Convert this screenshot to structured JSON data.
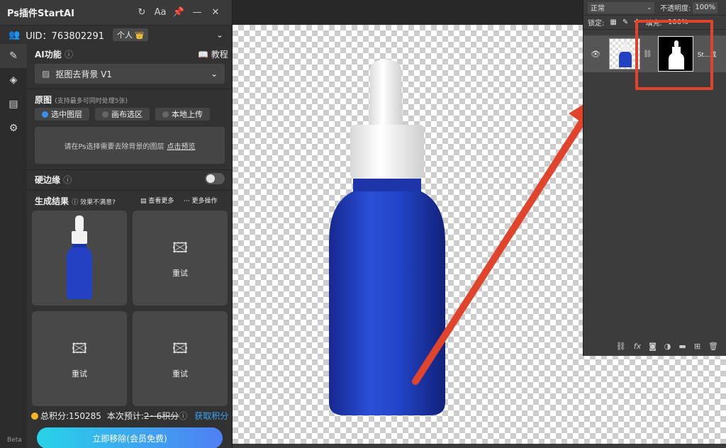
{
  "plugin": {
    "title": "Ps插件StartAI",
    "titlebar_icons": {
      "refresh": "↻",
      "font": "Aa",
      "pin": "📌",
      "minimize": "—",
      "close": "✕"
    },
    "uid_label": "UID：763802291",
    "plan_badge": "个人",
    "crown_icon": "👑",
    "ai_function": {
      "title": "AI功能",
      "tutorial_label": "教程",
      "selected_tool": "抠图去背景 V1"
    },
    "source": {
      "title": "原图",
      "hint": "(支持最多可同时处理5张)",
      "options": [
        "选中图层",
        "画布选区",
        "本地上传"
      ],
      "selected_index": 0,
      "prompt": "请在Ps选择需要去除背景的图层",
      "preview_link": "点击预览"
    },
    "hard_edge": {
      "label": "硬边缘",
      "enabled": false
    },
    "results": {
      "title": "生成结果",
      "dissatisfied": "效果不满意?",
      "view_more": "查看更多",
      "more_actions": "更多操作",
      "retry_label": "重试"
    },
    "points": {
      "total": "总积分:150285",
      "estimate_label": "本次预计:",
      "estimate_value": "2~6积分",
      "get_points": "获取积分"
    },
    "cta_label": "立即移除(会员免费)",
    "beta_label": "Beta"
  },
  "layers_panel": {
    "blend_mode": "正常",
    "opacity_label": "不透明度:",
    "opacity_value": "100%",
    "lock_label": "锁定:",
    "fill_label": "填充:",
    "fill_value": "100%",
    "layer_name": "St...成"
  },
  "colors": {
    "accent_blue": "#3a8ef0",
    "cta_gradient_start": "#28d3e8",
    "cta_gradient_end": "#4f7ff5",
    "annotation_red": "#e0442c",
    "bottle_blue": "#1f3fbf",
    "coin_gold": "#f3b626"
  }
}
